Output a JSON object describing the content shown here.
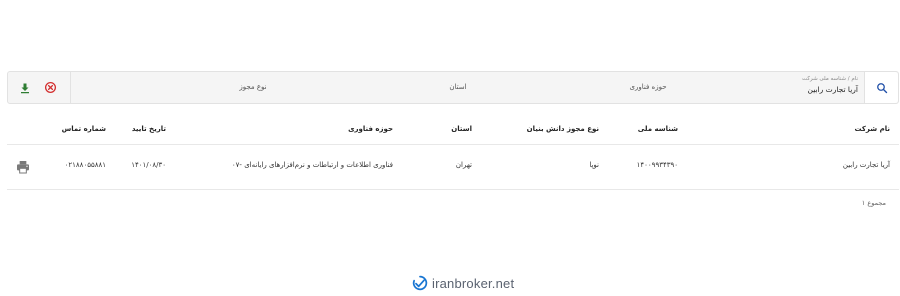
{
  "search": {
    "company_hint": "نام / شناسه ملی شرکت",
    "company_value": "آریا تجارت رابین",
    "tech_placeholder": "حوزه فناوری",
    "province_placeholder": "استان",
    "license_placeholder": "نوع مجوز",
    "icons": {
      "search": "search-icon",
      "clear": "close-circle-icon",
      "download": "download-icon"
    },
    "colors": {
      "search_icon": "#1f4fa8",
      "clear_icon": "#d32f2f",
      "download_icon": "#2e7d32"
    }
  },
  "table": {
    "headers": {
      "company": "نام شرکت",
      "national_id": "شناسه ملی",
      "license_type": "نوع مجوز دانش بنیان",
      "province": "استان",
      "tech_field": "حوزه فناوری",
      "approval_date": "تاریخ تایید",
      "phone": "شماره تماس"
    },
    "rows": [
      {
        "company": "آریا تجارت رابین",
        "national_id": "۱۴۰۰۹۹۳۴۳۹۰",
        "license_type": "نوپا",
        "province": "تهران",
        "tech_field": "۰۷- فناوری اطلاعات و ارتباطات و نرم‌افزارهای رایانه‌ای",
        "approval_date": "۱۴۰۱/۰۸/۳۰",
        "phone": "۰۲۱۸۸۰۵۵۸۸۱",
        "action_icon": "print-icon"
      }
    ]
  },
  "footer": {
    "total": "۱ مجموع",
    "brand": "iranbroker.net",
    "brand_icon": "iranbroker-logo-icon",
    "brand_color": "#1976d2"
  }
}
